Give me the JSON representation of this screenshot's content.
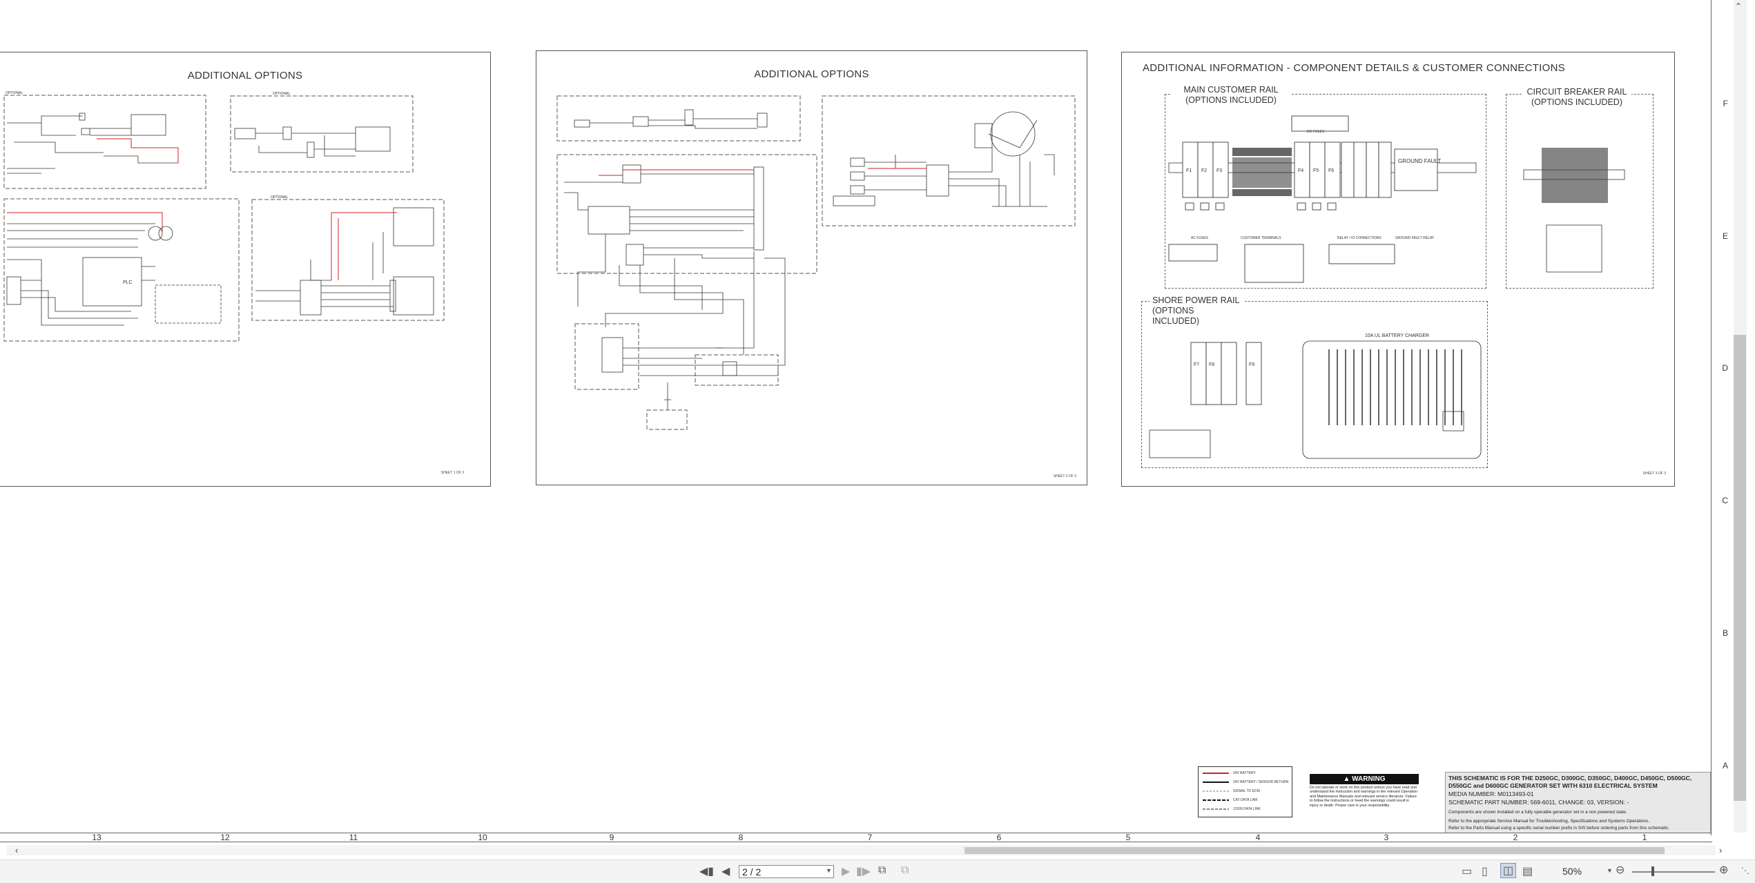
{
  "sheets": {
    "left_title": "ADDITIONAL OPTIONS",
    "middle_title": "ADDITIONAL OPTIONS",
    "right_title": "ADDITIONAL INFORMATION - COMPONENT DETAILS & CUSTOMER CONNECTIONS",
    "left_sheet_no": "SHEET 1 OF 3",
    "middle_sheet_no": "SHEET 2 OF 3",
    "right_sheet_no": "SHEET 3 OF 3"
  },
  "left_sheet": {
    "plc_label": "PLC",
    "optional_1": "OPTIONAL",
    "optional_2": "OPTIONAL",
    "optional_3": "OPTIONAL"
  },
  "right_sheet": {
    "main_rail_title_1": "MAIN CUSTOMER RAIL",
    "main_rail_title_2": "(OPTIONS INCLUDED)",
    "breaker_rail_title_1": "CIRCUIT BREAKER RAIL",
    "breaker_rail_title_2": "(OPTIONS INCLUDED)",
    "shore_rail_title_1": "SHORE POWER RAIL",
    "shore_rail_title_2": "(OPTIONS INCLUDED)",
    "ground_fault": "GROUND FAULT",
    "fuses_label": "DC FUSES",
    "battery_charger": "10A UL BATTERY CHARGER",
    "f_labels": [
      "F1",
      "F2",
      "F3",
      "F4",
      "F5",
      "F6"
    ],
    "shore_f_labels": [
      "F7",
      "F8",
      "F9"
    ],
    "bottom_labels": [
      "AC FUSES",
      "CUSTOMER TERMINALS",
      "RELAY / IO CONNECTIONS",
      "GROUND FAULT RELAY"
    ]
  },
  "legend": {
    "items": [
      "24V BATTERY",
      "24V BATTERY / SENSOR RETURN",
      "SIGNAL TO ECM",
      "CAT DATA LINK",
      "J1939 DATA LINK"
    ]
  },
  "warning": {
    "title": "WARNING",
    "text": "Do not operate or work on this product unless you have read and understand the instruction and warnings in the relevant Operation and Maintenance Manuals and relevant service literature. Failure to follow the instructions or heed the warnings could result in injury or death. Proper care is your responsibility."
  },
  "title_block": {
    "line1": "THIS SCHEMATIC IS FOR THE D250GC, D300GC, D350GC, D400GC, D450GC, D500GC,",
    "line2": "D550GC and D600GC GENERATOR SET WITH 6310 ELECTRICAL SYSTEM",
    "line3": "MEDIA NUMBER: M0113493-01",
    "line4": "SCHEMATIC PART NUMBER: 569-6011, CHANGE: 03, VERSION: -",
    "line5": "Components are shown installed on a fully operable generator set in a non powered state.",
    "line6": "Refer to the appropriate Service Manual for Troubleshooting, Specifications and Systems Operations.",
    "line7": "Refer to the Parts Manual using a specific serial number prefix in SIS before ordering parts from this schematic."
  },
  "ruler_h": [
    "13",
    "12",
    "11",
    "10",
    "9",
    "8",
    "7",
    "6",
    "5",
    "4",
    "3",
    "2",
    "1"
  ],
  "ruler_v": [
    "F",
    "E",
    "D",
    "C",
    "B",
    "A"
  ],
  "toolbar": {
    "page_value": "2 / 2",
    "zoom_value": "50%"
  },
  "colors": {
    "wire_red": "#d22020",
    "line": "#333333"
  }
}
